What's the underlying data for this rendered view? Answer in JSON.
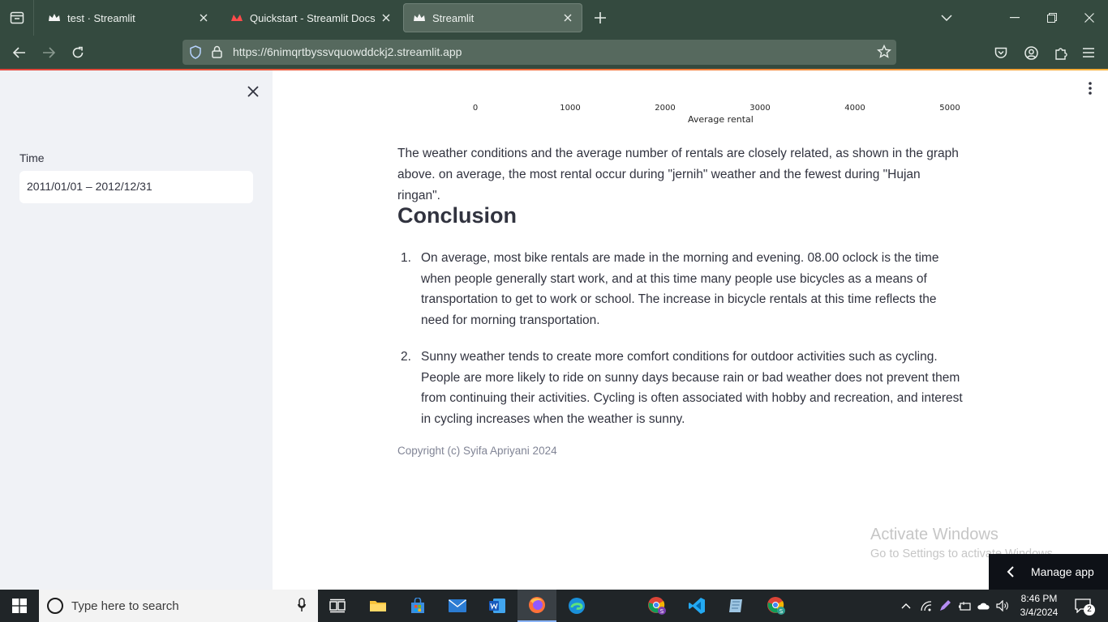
{
  "browser": {
    "tabs": [
      {
        "title": "test · Streamlit",
        "favicon": "streamlit-crown-icon",
        "active": false
      },
      {
        "title": "Quickstart - Streamlit Docs",
        "favicon": "streamlit-red-icon",
        "active": false
      },
      {
        "title": "Streamlit",
        "favicon": "streamlit-crown-icon",
        "active": true
      }
    ],
    "url": "https://6nimqrtbyssvquowddckj2.streamlit.app"
  },
  "sidebar": {
    "time_label": "Time",
    "date_range": "2011/01/01 – 2012/12/31"
  },
  "chart_fragment": {
    "x_ticks": [
      "0",
      "1000",
      "2000",
      "3000",
      "4000",
      "5000"
    ],
    "xlabel": "Average rental"
  },
  "content": {
    "paragraph": "The weather conditions and the average number of rentals are closely related, as shown in the graph above. on average, the most rental occur during \"jernih\" weather and the fewest during \"Hujan ringan\".",
    "heading": "Conclusion",
    "list": [
      {
        "num": "1.",
        "text": "On average, most bike rentals are made in the morning and evening. 08.00 oclock is the time when people generally start work, and at this time many people use bicycles as a means of transportation to get to work or school. The increase in bicycle rentals at this time reflects the need for morning transportation."
      },
      {
        "num": "2.",
        "text": "Sunny weather tends to create more comfort conditions for outdoor activities such as cycling. People are more likely to ride on sunny days because rain or bad weather does not prevent them from continuing their activities. Cycling is often associated with hobby and recreation, and interest in cycling increases when the weather is sunny."
      }
    ],
    "copyright": "Copyright (c) Syifa Apriyani 2024"
  },
  "watermark": {
    "line1": "Activate Windows",
    "line2": "Go to Settings to activate Windows."
  },
  "manage_app": "Manage app",
  "taskbar": {
    "search_placeholder": "Type here to search",
    "time": "8:46 PM",
    "date": "3/4/2024",
    "notifications": "2"
  }
}
